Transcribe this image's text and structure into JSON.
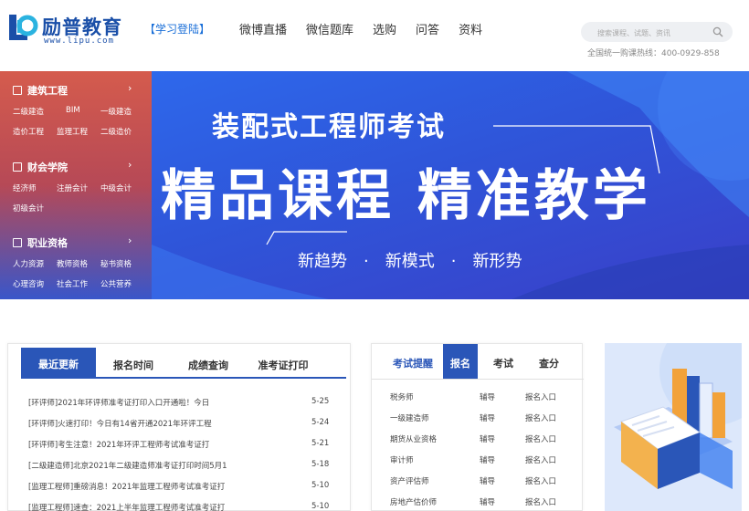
{
  "logo": {
    "title": "励普教育",
    "url": "www.lipu.com"
  },
  "header": {
    "login_label": "【学习登陆】",
    "nav": [
      "微博直播",
      "微信题库",
      "选购",
      "问答",
      "资料"
    ],
    "search_placeholder": "搜索课程、试题、资讯",
    "hotline": "全国统一购课热线：400-0929-858"
  },
  "side_menu": [
    {
      "title": "建筑工程",
      "links": [
        "二级建造",
        "BIM",
        "一级建造",
        "造价工程",
        "监理工程",
        "二级造价"
      ]
    },
    {
      "title": "财会学院",
      "links": [
        "经济师",
        "注册会计",
        "中级会计",
        "初级会计"
      ]
    },
    {
      "title": "职业资格",
      "links": [
        "人力资源",
        "教师资格",
        "秘书资格",
        "心理咨询",
        "社会工作",
        "公共营养"
      ]
    }
  ],
  "banner": {
    "title": "装配式工程师考试",
    "main": "精品课程 精准教学",
    "sub": [
      "新趋势",
      "新模式",
      "新形势"
    ],
    "separator": "·"
  },
  "news_panel": {
    "tabs": [
      "最近更新",
      "报名时间",
      "成绩查询",
      "准考证打印"
    ],
    "items": [
      {
        "title": "[环评师]2021年环评师准考证打印入口开通啦！今日",
        "date": "5-25"
      },
      {
        "title": "[环评师]火速打印！今日有14省开通2021年环评工程",
        "date": "5-24"
      },
      {
        "title": "[环评师]考生注意！2021年环评工程师考试准考证打",
        "date": "5-21"
      },
      {
        "title": "[二级建造师]北京2021年二级建造师准考证打印时间5月1",
        "date": "5-18"
      },
      {
        "title": "[监理工程师]重磅消息！2021年监理工程师考试准考证打",
        "date": "5-10"
      },
      {
        "title": "[监理工程师]速查：2021上半年监理工程师考试准考证打",
        "date": "5-10"
      }
    ]
  },
  "exam_panel": {
    "tabs": [
      "考试提醒",
      "报名",
      "考试",
      "查分"
    ],
    "rows": [
      {
        "name": "税务师",
        "guide": "辅导",
        "entry": "报名入口"
      },
      {
        "name": "一级建造师",
        "guide": "辅导",
        "entry": "报名入口"
      },
      {
        "name": "期货从业资格",
        "guide": "辅导",
        "entry": "报名入口"
      },
      {
        "name": "审计师",
        "guide": "辅导",
        "entry": "报名入口"
      },
      {
        "name": "资产评估师",
        "guide": "辅导",
        "entry": "报名入口"
      },
      {
        "name": "房地产估价师",
        "guide": "辅导",
        "entry": "报名入口"
      }
    ]
  },
  "colors": {
    "brand": "#1a4fa8",
    "accent": "#2a56b8",
    "menu_top": "#e06048",
    "banner_blue": "#2f5ce0"
  }
}
